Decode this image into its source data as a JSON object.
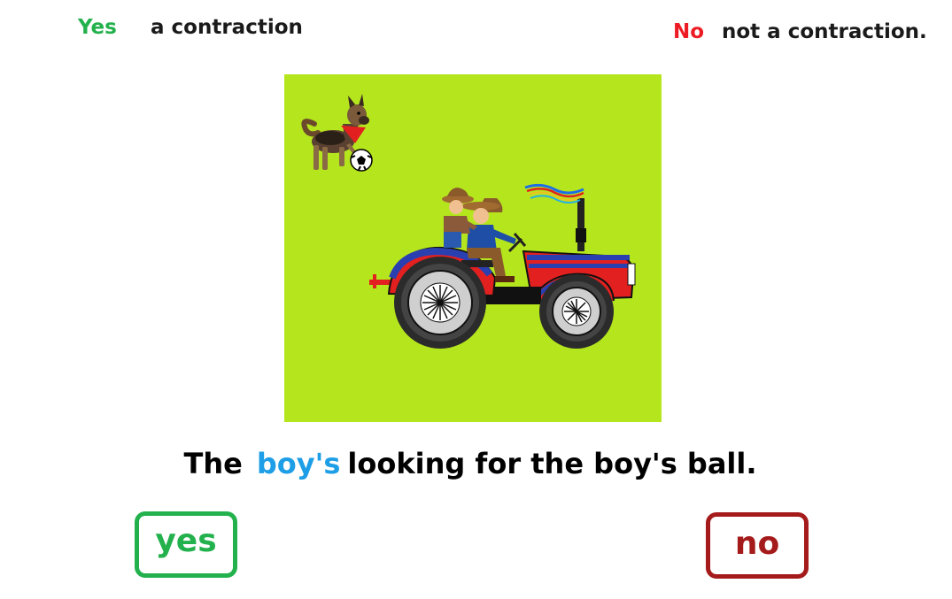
{
  "legend": {
    "yes_label": "Yes",
    "yes_description": "a contraction",
    "no_label": "No",
    "no_description": "not a contraction."
  },
  "sentence": {
    "before": "The",
    "highlight": "boy's",
    "after": "looking for the boy's ball."
  },
  "buttons": {
    "yes_label": "yes",
    "no_label": "no"
  },
  "colors": {
    "yes_green": "#22b14c",
    "no_red": "#ed1c24",
    "no_button_red": "#a51a1a",
    "highlight_blue": "#1e9ee6",
    "scene_background": "#b5e61d"
  }
}
